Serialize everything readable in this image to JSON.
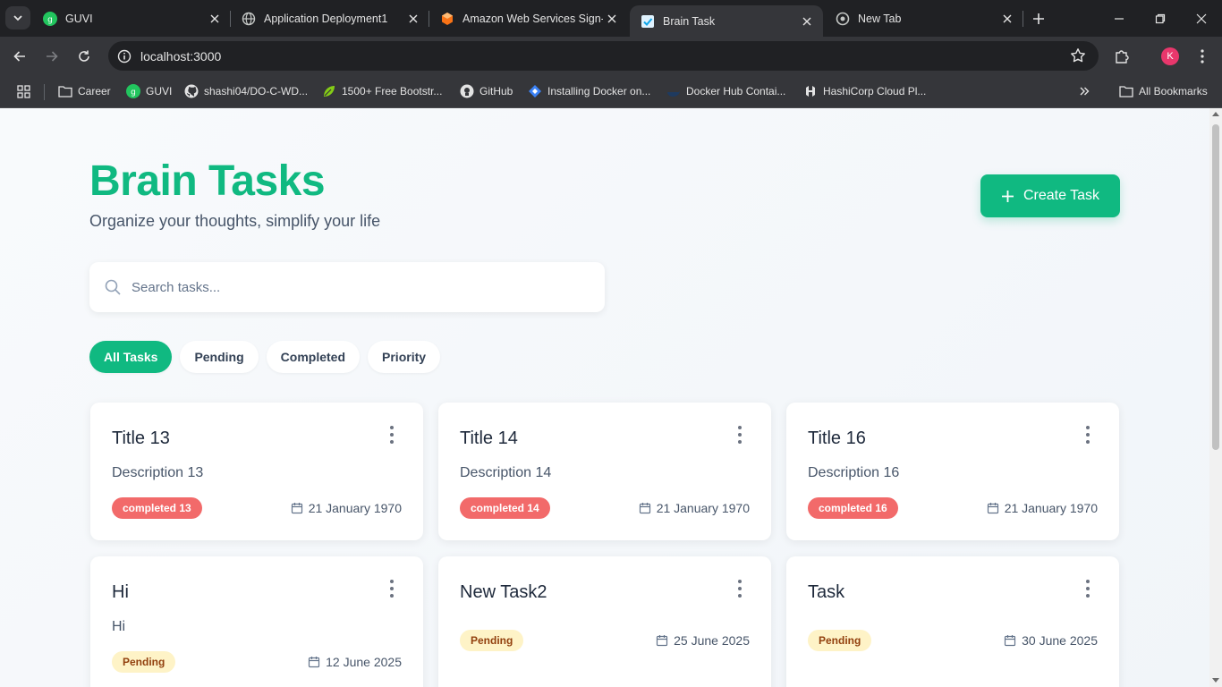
{
  "browser": {
    "tabs": [
      {
        "title": "GUVI",
        "icon": "guvi-icon",
        "active": false
      },
      {
        "title": "Application Deployment1",
        "icon": "globe-icon",
        "active": false
      },
      {
        "title": "Amazon Web Services Sign-In",
        "icon": "aws-icon",
        "active": false
      },
      {
        "title": "Brain Task",
        "icon": "check-icon",
        "active": true
      },
      {
        "title": "New Tab",
        "icon": "chrome-icon",
        "active": false
      }
    ],
    "url": "localhost:3000",
    "profile_initial": "K",
    "bookmarks": [
      {
        "label": "Career",
        "icon": "folder-icon"
      },
      {
        "label": "GUVI",
        "icon": "guvi-icon"
      },
      {
        "label": "shashi04/DO-C-WD...",
        "icon": "github-icon"
      },
      {
        "label": "1500+ Free Bootstr...",
        "icon": "leaf-icon"
      },
      {
        "label": "GitHub",
        "icon": "github-icon"
      },
      {
        "label": "Installing Docker on...",
        "icon": "diamond-icon"
      },
      {
        "label": "Docker Hub Contai...",
        "icon": "docker-icon"
      },
      {
        "label": "HashiCorp Cloud Pl...",
        "icon": "hashicorp-icon"
      }
    ],
    "all_bookmarks": "All Bookmarks"
  },
  "app": {
    "title": "Brain Tasks",
    "subtitle": "Organize your thoughts, simplify your life",
    "create_label": "Create Task",
    "search_placeholder": "Search tasks...",
    "filters": [
      "All Tasks",
      "Pending",
      "Completed",
      "Priority"
    ],
    "active_filter": "All Tasks",
    "accent": "#10b981"
  },
  "tasks": [
    {
      "title": "Title 13",
      "description": "Description 13",
      "status": "completed 13",
      "status_type": "completed",
      "date": "21 January 1970"
    },
    {
      "title": "Title 14",
      "description": "Description 14",
      "status": "completed 14",
      "status_type": "completed",
      "date": "21 January 1970"
    },
    {
      "title": "Title 16",
      "description": "Description 16",
      "status": "completed 16",
      "status_type": "completed",
      "date": "21 January 1970"
    },
    {
      "title": "Hi",
      "description": "Hi",
      "status": "Pending",
      "status_type": "pending",
      "date": "12 June 2025"
    },
    {
      "title": "New Task2",
      "description": "",
      "status": "Pending",
      "status_type": "pending",
      "date": "25 June 2025"
    },
    {
      "title": "Task",
      "description": "",
      "status": "Pending",
      "status_type": "pending",
      "date": "30 June 2025"
    }
  ]
}
